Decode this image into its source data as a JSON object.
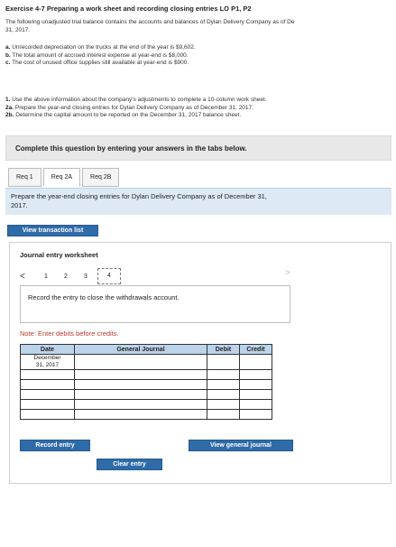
{
  "header": {
    "title": "Exercise 4-7 Preparing a work sheet and recording closing entries LO P1, P2"
  },
  "intro": "The following unadjusted trial balance contains the accounts and balances of Dylan Delivery Company as of De\n31, 2017.",
  "info_items": [
    {
      "letter": "a.",
      "text": "Unrecorded depreciation on the trucks at the end of the year is $9,602."
    },
    {
      "letter": "b.",
      "text": "The total amount of accrued interest expense at year-end is $8,000."
    },
    {
      "letter": "c.",
      "text": "The cost of unused office supplies still available at year-end is $900."
    }
  ],
  "requirements": [
    {
      "letter": "1.",
      "text": "Use the above information about the company's adjustments to complete a 10-column work sheet."
    },
    {
      "letter": "2a.",
      "text": "Prepare the year-end closing entries for Dylan Delivery Company as of December 31, 2017."
    },
    {
      "letter": "2b.",
      "text": "Determine the capital amount to be reported on the December 31, 2017 balance sheet."
    }
  ],
  "complete_bar": "Complete this question by entering your answers in the tabs below.",
  "tabs": [
    {
      "label": "Req 1"
    },
    {
      "label": "Req 2A"
    },
    {
      "label": "Req 2B"
    }
  ],
  "active_tab": "Req 2A",
  "prompt": "Prepare the year-end closing entries for Dylan Delivery Company as of December 31,\n2017.",
  "view_transaction_list": "View transaction list",
  "worksheet": {
    "title": "Journal entry worksheet",
    "pages": [
      "1",
      "2",
      "3",
      "4"
    ],
    "current_page": "4",
    "left_arrow": "<",
    "right_arrow": ">",
    "instruction": "Record the entry to close the withdrawals account.",
    "note": "Note: Enter debits before credits.",
    "columns": {
      "date": "Date",
      "journal": "General Journal",
      "debit": "Debit",
      "credit": "Credit"
    },
    "first_date": "December\n31, 2017",
    "rows": 6
  },
  "buttons": {
    "record_entry": "Record entry",
    "clear_entry": "Clear entry",
    "view_general_journal": "View general journal"
  },
  "colors": {
    "accent": "#2f6ba8",
    "prompt_bg": "#ddeaf5",
    "table_header": "#bcd3ea",
    "note": "#c0392b"
  }
}
